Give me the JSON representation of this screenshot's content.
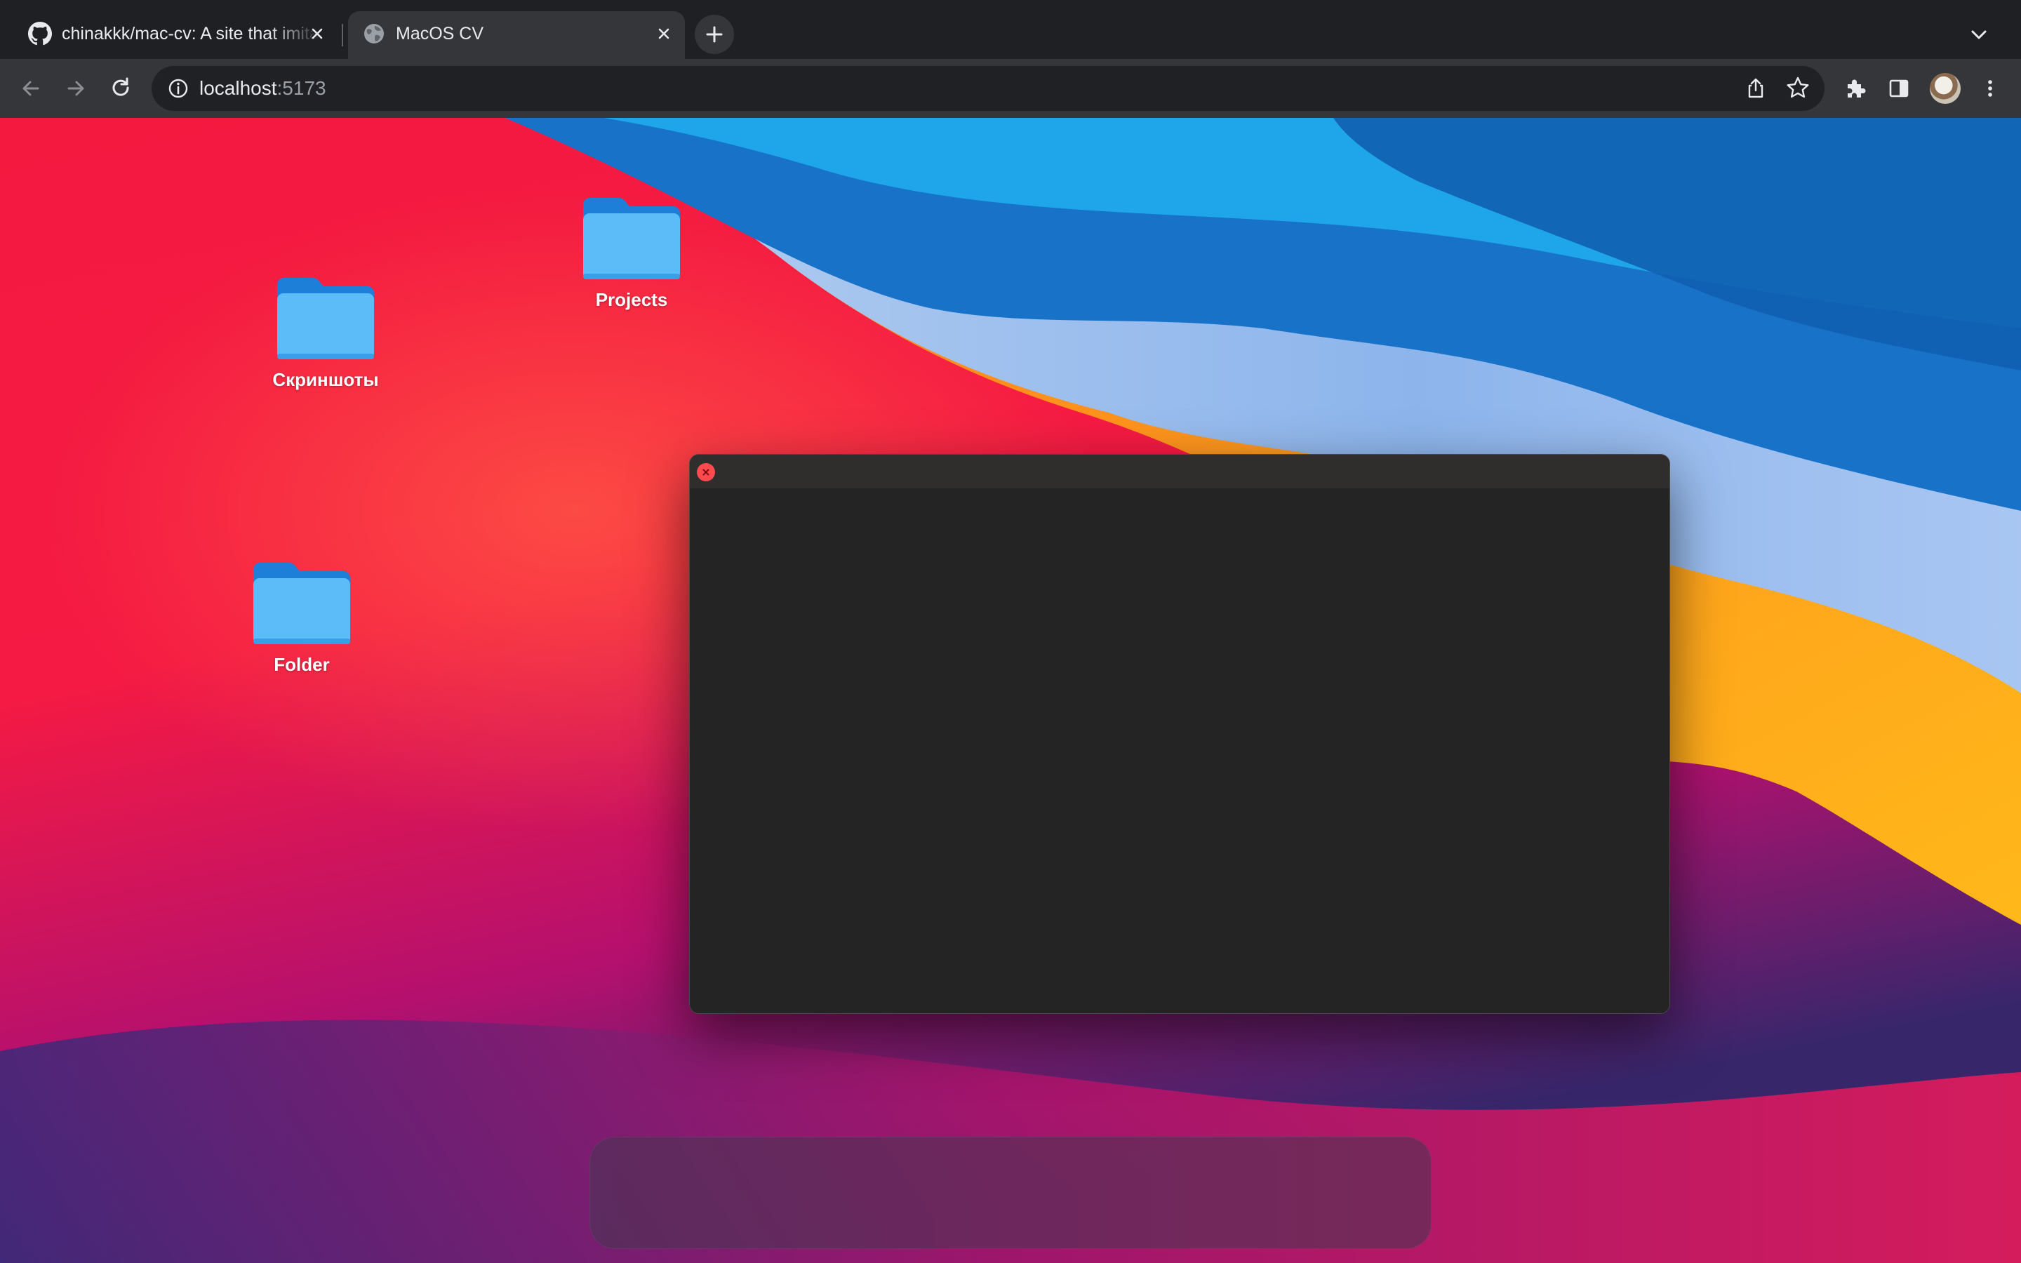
{
  "browser": {
    "tabs": [
      {
        "title": "chinakkk/mac-cv: A site that imitates macOS",
        "favicon": "github-icon",
        "active": false
      },
      {
        "title": "MacOS CV",
        "favicon": "globe-icon",
        "active": true
      }
    ],
    "address": {
      "host": "localhost",
      "port": ":5173"
    },
    "colors": {
      "frame": "#1f2023",
      "toolbar": "#35363a",
      "omnibox": "#202124",
      "text": "#e8eaed"
    }
  },
  "desktop": {
    "icons": [
      {
        "label": "Скриншоты",
        "icon": "folder-icon"
      },
      {
        "label": "Projects",
        "icon": "folder-icon"
      },
      {
        "label": "Folder",
        "icon": "folder-icon"
      }
    ],
    "window": {
      "close_icon": "close-icon",
      "close_color": "#ff4a4f",
      "background": "#242424"
    },
    "dock": {
      "items": []
    },
    "wallpaper": "macos-big-sur-wallpaper"
  }
}
